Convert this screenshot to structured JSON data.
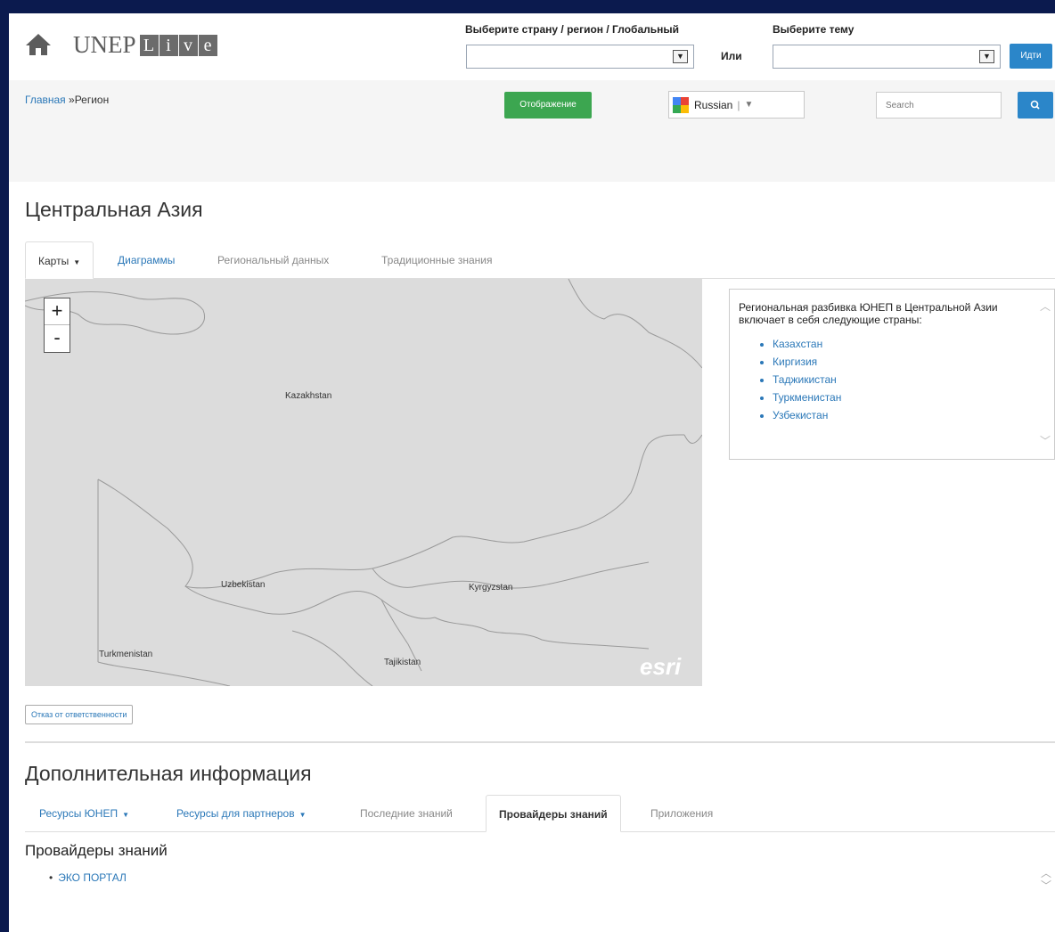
{
  "header": {
    "logo_main": "UNEP",
    "logo_live_letters": [
      "L",
      "i",
      "v",
      "e"
    ],
    "country_label": "Выберите страну / регион / Глобальный",
    "theme_label": "Выберите тему",
    "or_label": "Или",
    "go_label": "Идти"
  },
  "toolbar": {
    "breadcrumb_home": "Главная",
    "breadcrumb_sep": " »",
    "breadcrumb_current": "Регион",
    "display_label": "Отображение",
    "language": "Russian",
    "search_placeholder": "Search"
  },
  "main": {
    "title": "Центральная Азия",
    "tabs": [
      {
        "label": "Карты",
        "dropdown": true,
        "state": "active"
      },
      {
        "label": "Диаграммы",
        "state": "link"
      },
      {
        "label": "Региональный данных",
        "state": "muted"
      },
      {
        "label": "Традиционные знания",
        "state": "muted"
      }
    ],
    "map": {
      "zoom_in": "+",
      "zoom_out": "-",
      "labels": [
        "Kazakhstan",
        "Uzbekistan",
        "Kyrgyzstan",
        "Turkmenistan",
        "Tajikistan"
      ],
      "attribution": "esri"
    },
    "info": {
      "text": "Региональная разбивка ЮНЕП в Центральной Азии включает в себя следующие страны:",
      "countries": [
        "Казахстан",
        "Киргизия",
        "Таджикистан",
        "Туркменистан",
        "Узбекистан"
      ]
    },
    "disclaimer": "Отказ от ответственности"
  },
  "additional": {
    "title": "Дополнительная информация",
    "tabs": [
      {
        "label": "Ресурсы ЮНЕП",
        "dropdown": true,
        "state": "link"
      },
      {
        "label": "Ресурсы для партнеров",
        "dropdown": true,
        "state": "link"
      },
      {
        "label": "Последние знаний",
        "state": "muted"
      },
      {
        "label": "Провайдеры знаний",
        "state": "active"
      },
      {
        "label": "Приложения",
        "state": "muted"
      }
    ],
    "panel_title": "Провайдеры знаний",
    "items": [
      "ЭКО ПОРТАЛ"
    ]
  },
  "colors": {
    "frame": "#0b1a4e",
    "primary_blue": "#2b86c9",
    "green": "#3ca650",
    "link": "#2b78b8"
  }
}
